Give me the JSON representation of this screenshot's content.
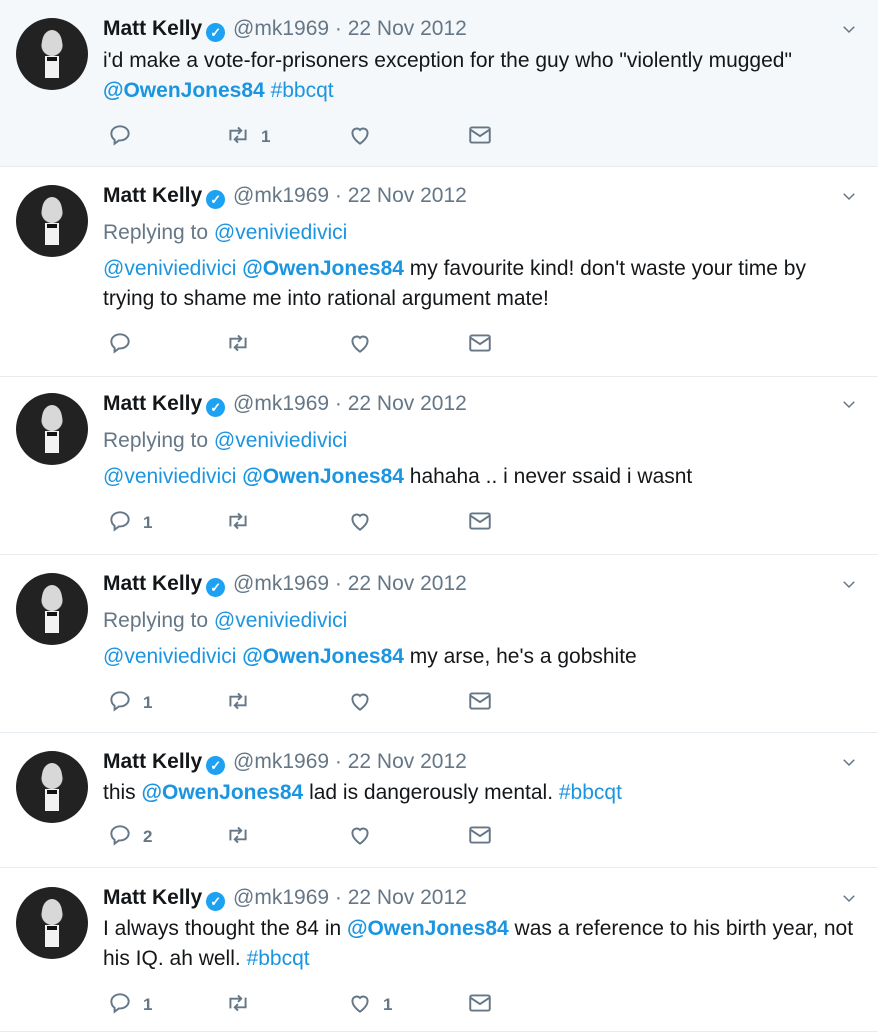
{
  "tweets": [
    {
      "name": "Matt Kelly",
      "handle": "@mk1969",
      "date": "22 Nov 2012",
      "replying_to": "",
      "parts": [
        {
          "t": "i'd make a vote-for-prisoners exception for the guy who \"violently mugged\" ",
          "c": ""
        },
        {
          "t": "@OwenJones84",
          "c": "link bold"
        },
        {
          "t": " ",
          "c": ""
        },
        {
          "t": "#bbcqt",
          "c": "link"
        }
      ],
      "reply_count": "",
      "retweet_count": "1",
      "like_count": ""
    },
    {
      "name": "Matt Kelly",
      "handle": "@mk1969",
      "date": "22 Nov 2012",
      "replying_to": "@veniviedivici",
      "parts": [
        {
          "t": "@veniviedivici",
          "c": "link"
        },
        {
          "t": " ",
          "c": ""
        },
        {
          "t": "@OwenJones84",
          "c": "link bold"
        },
        {
          "t": " my favourite kind! don't waste your time by trying to shame me into rational argument mate!",
          "c": ""
        }
      ],
      "reply_count": "",
      "retweet_count": "",
      "like_count": ""
    },
    {
      "name": "Matt Kelly",
      "handle": "@mk1969",
      "date": "22 Nov 2012",
      "replying_to": "@veniviedivici",
      "parts": [
        {
          "t": "@veniviedivici",
          "c": "link"
        },
        {
          "t": " ",
          "c": ""
        },
        {
          "t": "@OwenJones84",
          "c": "link bold"
        },
        {
          "t": " hahaha .. i never ssaid i wasnt",
          "c": ""
        }
      ],
      "reply_count": "1",
      "retweet_count": "",
      "like_count": ""
    },
    {
      "name": "Matt Kelly",
      "handle": "@mk1969",
      "date": "22 Nov 2012",
      "replying_to": "@veniviedivici",
      "parts": [
        {
          "t": "@veniviedivici",
          "c": "link"
        },
        {
          "t": " ",
          "c": ""
        },
        {
          "t": "@OwenJones84",
          "c": "link bold"
        },
        {
          "t": " my arse, he's a gobshite",
          "c": ""
        }
      ],
      "reply_count": "1",
      "retweet_count": "",
      "like_count": ""
    },
    {
      "name": "Matt Kelly",
      "handle": "@mk1969",
      "date": "22 Nov 2012",
      "replying_to": "",
      "parts": [
        {
          "t": "this ",
          "c": ""
        },
        {
          "t": "@OwenJones84",
          "c": "link bold"
        },
        {
          "t": " lad is dangerously mental. ",
          "c": ""
        },
        {
          "t": "#bbcqt",
          "c": "link"
        }
      ],
      "reply_count": "2",
      "retweet_count": "",
      "like_count": ""
    },
    {
      "name": "Matt Kelly",
      "handle": "@mk1969",
      "date": "22 Nov 2012",
      "replying_to": "",
      "parts": [
        {
          "t": "I always thought the 84 in ",
          "c": ""
        },
        {
          "t": "@OwenJones84",
          "c": "link bold"
        },
        {
          "t": " was a reference to his birth year, not his IQ. ah well. ",
          "c": ""
        },
        {
          "t": "#bbcqt",
          "c": "link"
        }
      ],
      "reply_count": "1",
      "retweet_count": "",
      "like_count": "1"
    }
  ],
  "ui": {
    "replying_prefix": "Replying to ",
    "verified_mark": "✓",
    "sep": " · "
  },
  "colors": {
    "link": "#1b95e0",
    "meta": "#657786",
    "verified": "#1da1f2",
    "highlight_bg": "#f5f8fa"
  }
}
